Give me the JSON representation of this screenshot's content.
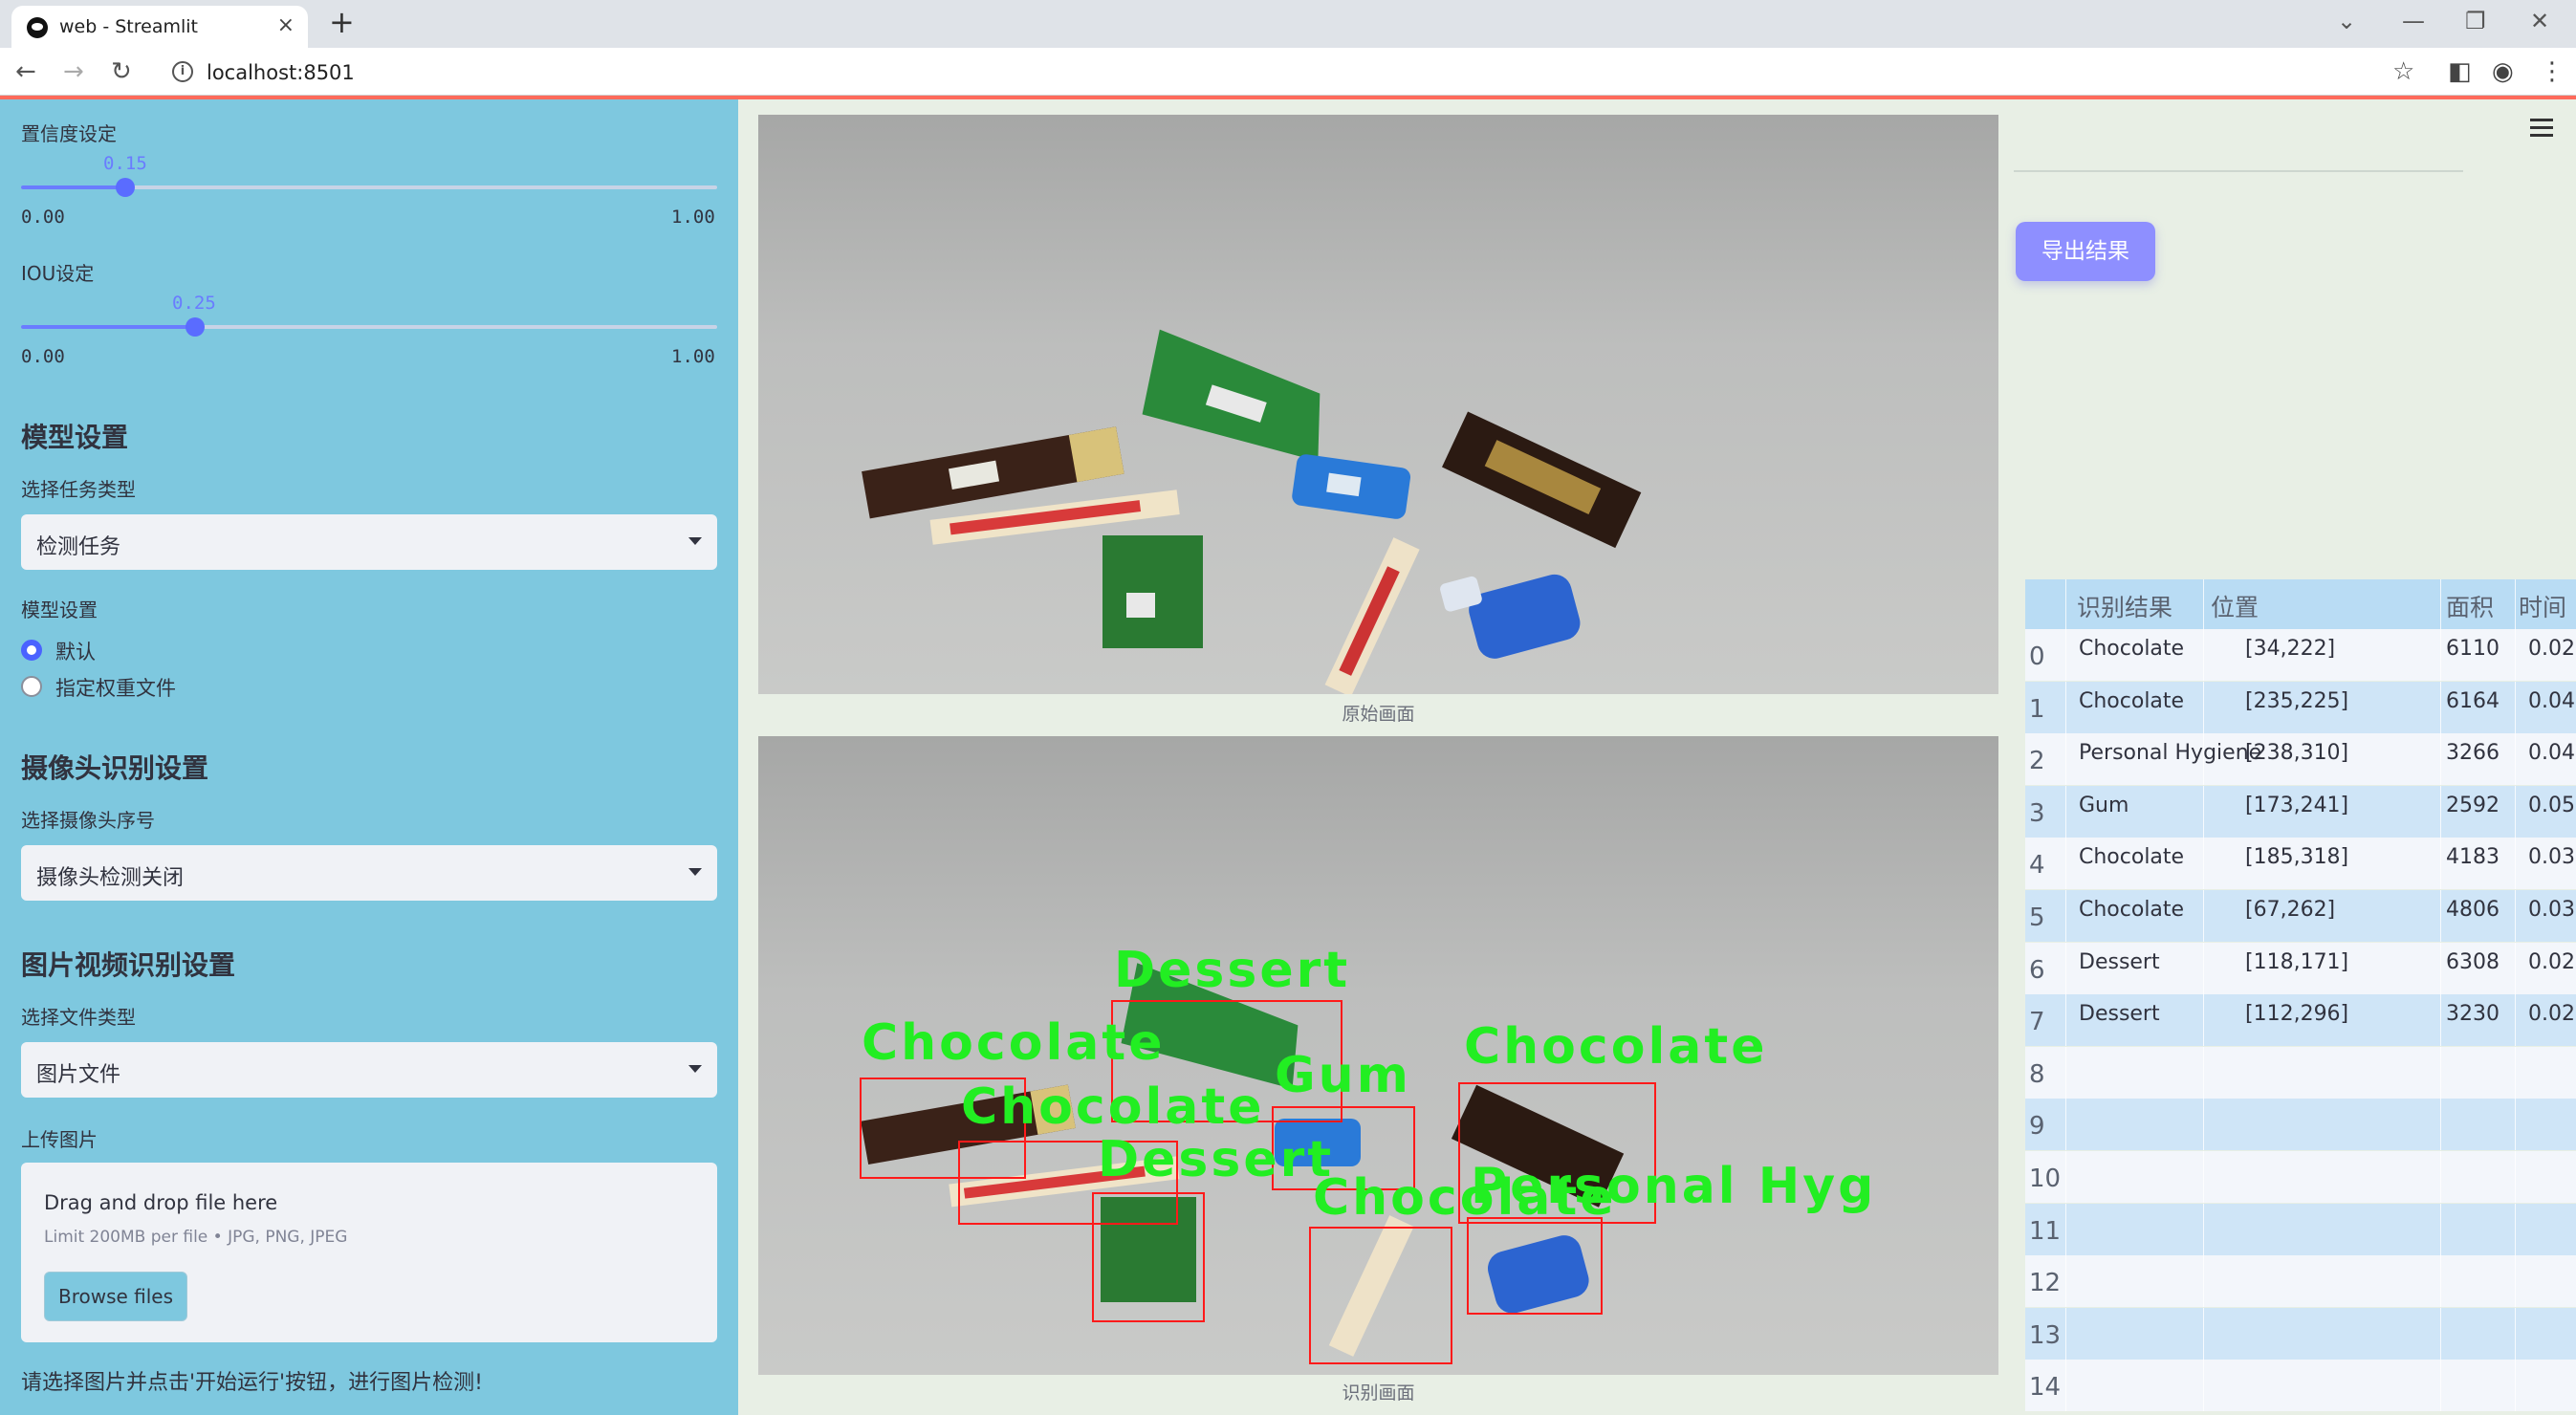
{
  "browser": {
    "tab_title": "web - Streamlit",
    "tab_close": "×",
    "new_tab": "+",
    "url": "localhost:8501"
  },
  "sidebar": {
    "confidence": {
      "label": "置信度设定",
      "value": "0.15",
      "fraction": 0.15,
      "min": "0.00",
      "max": "1.00"
    },
    "iou": {
      "label": "IOU设定",
      "value": "0.25",
      "fraction": 0.25,
      "min": "0.00",
      "max": "1.00"
    },
    "model_section": {
      "heading": "模型设置",
      "task_label": "选择任务类型",
      "task_value": "检测任务",
      "model_label": "模型设置",
      "options": [
        {
          "label": "默认",
          "selected": true
        },
        {
          "label": "指定权重文件",
          "selected": false
        }
      ]
    },
    "camera_section": {
      "heading": "摄像头识别设置",
      "camera_label": "选择摄像头序号",
      "camera_value": "摄像头检测关闭"
    },
    "media_section": {
      "heading": "图片视频识别设置",
      "filetype_label": "选择文件类型",
      "filetype_value": "图片文件",
      "upload_label": "上传图片",
      "drop_title": "Drag and drop file here",
      "drop_limit": "Limit 200MB per file • JPG, PNG, JPEG",
      "browse_label": "Browse files"
    },
    "footer_text": "请选择图片并点击'开始运行'按钮，进行图片检测!"
  },
  "main": {
    "original_caption": "原始画面",
    "result_caption": "识别画面",
    "detections": [
      {
        "label": "Chocolate"
      },
      {
        "label": "Chocolate"
      },
      {
        "label": "Dessert"
      },
      {
        "label": "Gum"
      },
      {
        "label": "Chocolate"
      },
      {
        "label": "Personal Hyg"
      },
      {
        "label": "Chocolate"
      },
      {
        "label": "Dessert"
      }
    ]
  },
  "right": {
    "export_label": "导出结果",
    "table": {
      "headers": [
        "识别结果",
        "位置",
        "面积",
        "时间"
      ],
      "rows": [
        {
          "idx": "0",
          "result": "Chocolate",
          "pos": "[34,222]",
          "area": "6110",
          "time": "0.02"
        },
        {
          "idx": "1",
          "result": "Chocolate",
          "pos": "[235,225]",
          "area": "6164",
          "time": "0.04"
        },
        {
          "idx": "2",
          "result": "Personal Hygiene",
          "pos": "[238,310]",
          "area": "3266",
          "time": "0.04"
        },
        {
          "idx": "3",
          "result": "Gum",
          "pos": "[173,241]",
          "area": "2592",
          "time": "0.05"
        },
        {
          "idx": "4",
          "result": "Chocolate",
          "pos": "[185,318]",
          "area": "4183",
          "time": "0.03"
        },
        {
          "idx": "5",
          "result": "Chocolate",
          "pos": "[67,262]",
          "area": "4806",
          "time": "0.03"
        },
        {
          "idx": "6",
          "result": "Dessert",
          "pos": "[118,171]",
          "area": "6308",
          "time": "0.02"
        },
        {
          "idx": "7",
          "result": "Dessert",
          "pos": "[112,296]",
          "area": "3230",
          "time": "0.02"
        },
        {
          "idx": "8",
          "result": "",
          "pos": "",
          "area": "",
          "time": ""
        },
        {
          "idx": "9",
          "result": "",
          "pos": "",
          "area": "",
          "time": ""
        },
        {
          "idx": "10",
          "result": "",
          "pos": "",
          "area": "",
          "time": ""
        },
        {
          "idx": "11",
          "result": "",
          "pos": "",
          "area": "",
          "time": ""
        },
        {
          "idx": "12",
          "result": "",
          "pos": "",
          "area": "",
          "time": ""
        },
        {
          "idx": "13",
          "result": "",
          "pos": "",
          "area": "",
          "time": ""
        },
        {
          "idx": "14",
          "result": "",
          "pos": "",
          "area": "",
          "time": ""
        }
      ]
    }
  },
  "colors": {
    "sidebar_bg": "#7ec8df",
    "accent": "#6a7cff",
    "export_button": "#8e8fff",
    "detection_box": "#ff1a1a",
    "detection_text": "#22ee22",
    "table_row_even": "#f3f6fb",
    "table_row_odd": "#cfe5f7"
  }
}
